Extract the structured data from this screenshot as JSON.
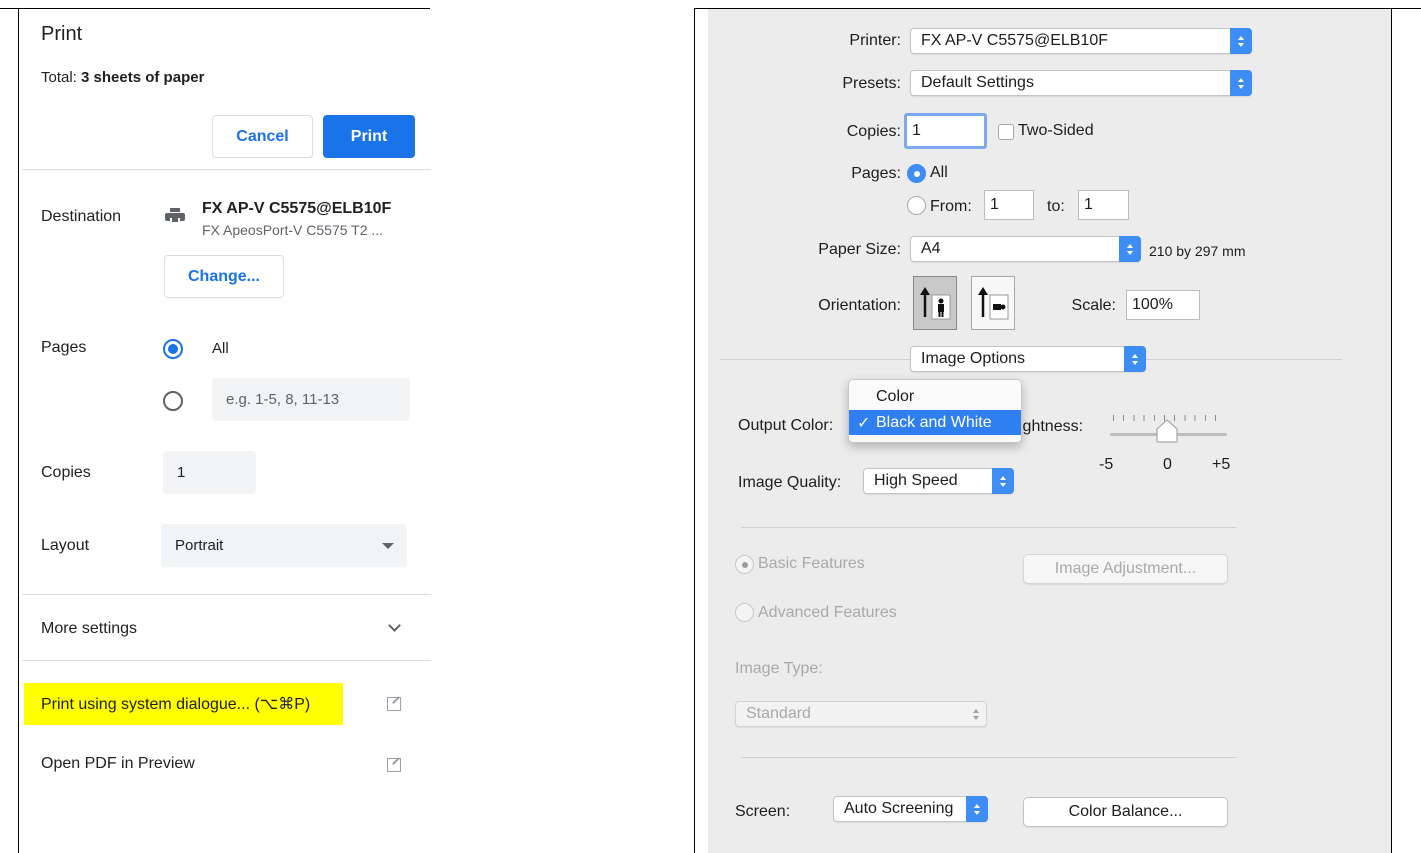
{
  "chrome_panel": {
    "title": "Print",
    "total_prefix": "Total: ",
    "total_value": "3 sheets of paper",
    "buttons": {
      "cancel": "Cancel",
      "print": "Print"
    },
    "destination": {
      "label": "Destination",
      "printer_name": "FX AP-V C5575@ELB10F",
      "printer_sub": "FX ApeosPort-V C5575 T2 ...",
      "change_button": "Change..."
    },
    "pages": {
      "label": "Pages",
      "all_option": "All",
      "custom_placeholder": "e.g. 1-5, 8, 11-13"
    },
    "copies": {
      "label": "Copies",
      "value": "1"
    },
    "layout": {
      "label": "Layout",
      "value": "Portrait"
    },
    "more_settings": "More settings",
    "system_dialogue_link": "Print using system dialogue... (⌥⌘P)",
    "open_pdf_link": "Open PDF in Preview",
    "highlight_color": "#ffff00",
    "accent_color": "#1a73e8"
  },
  "mac_dialog": {
    "printer": {
      "label": "Printer:",
      "value": "FX AP-V C5575@ELB10F"
    },
    "presets": {
      "label": "Presets:",
      "value": "Default Settings"
    },
    "copies": {
      "label": "Copies:",
      "value": "1",
      "two_sided": "Two-Sided"
    },
    "pages": {
      "label": "Pages:",
      "all": "All",
      "from_label": "From:",
      "from_value": "1",
      "to_label": "to:",
      "to_value": "1"
    },
    "paper_size": {
      "label": "Paper Size:",
      "value": "A4",
      "dimensions": "210 by 297 mm"
    },
    "orientation": {
      "label": "Orientation:"
    },
    "scale": {
      "label": "Scale:",
      "value": "100%"
    },
    "section_popup": "Image Options",
    "output_color": {
      "label": "Output Color:",
      "options": [
        "Color",
        "Black and White"
      ],
      "selected": "Black and White",
      "check": "✓"
    },
    "brightness": {
      "label_partial": "ightness:",
      "ticks": [
        "-5",
        "0",
        "+5"
      ],
      "value": 0
    },
    "image_quality": {
      "label": "Image Quality:",
      "value": "High Speed"
    },
    "basic_features": "Basic Features",
    "advanced_features": "Advanced Features",
    "image_adjustment_button": "Image Adjustment...",
    "image_type": {
      "label": "Image Type:",
      "value": "Standard"
    },
    "screen": {
      "label": "Screen:",
      "value": "Auto Screening"
    },
    "color_balance_button": "Color Balance...",
    "accent_color": "#3d8df5"
  }
}
